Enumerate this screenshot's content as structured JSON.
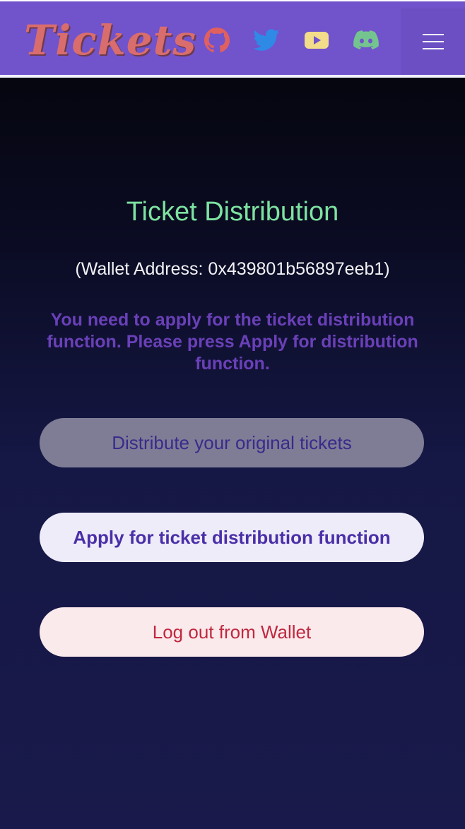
{
  "header": {
    "brand": "Tickets",
    "social": [
      "github-icon",
      "twitter-icon",
      "youtube-icon",
      "discord-icon"
    ],
    "menu_icon": "hamburger-menu-icon"
  },
  "main": {
    "title": "Ticket Distribution",
    "wallet_line": "(Wallet Address: 0x439801b56897eeb1)",
    "notice": "You need to apply for the ticket distribution function. Please press Apply for distribution function.",
    "buttons": {
      "distribute": "Distribute your original tickets",
      "apply": "Apply for ticket distribution function",
      "logout": "Log out from Wallet"
    }
  },
  "colors": {
    "navbar": "#7153cc",
    "brand": "#d96d6d",
    "title": "#7de3a1",
    "notice": "#6a40b8",
    "logout_text": "#c0283f"
  }
}
